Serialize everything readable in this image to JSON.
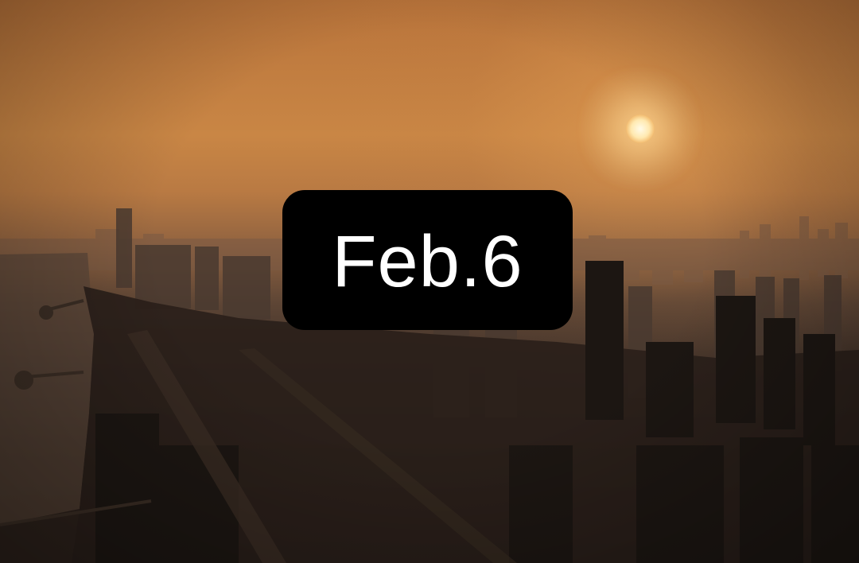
{
  "badge": {
    "date_text": "Feb.6",
    "background_color": "#000000",
    "text_color": "#ffffff"
  },
  "scene": {
    "sky_color": "#c98645",
    "sun_color": "#fffbe8",
    "skyline_color": "#2a201a"
  }
}
